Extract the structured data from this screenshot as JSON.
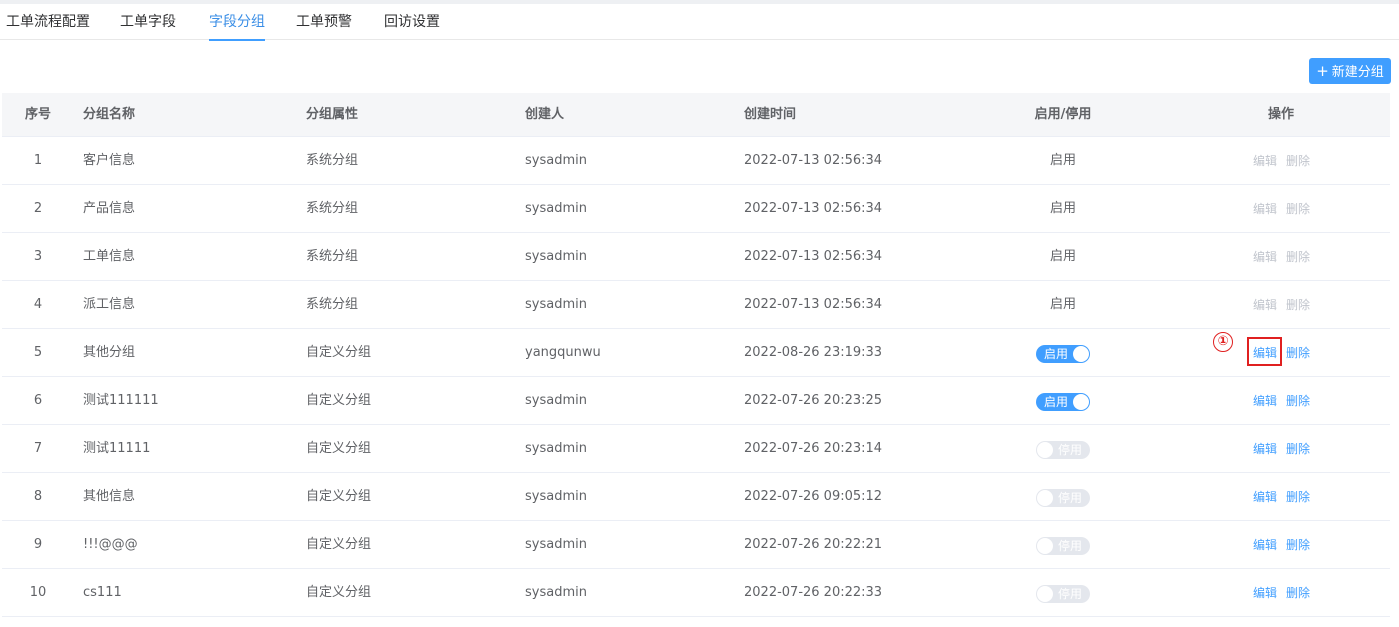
{
  "tabs": [
    {
      "label": "工单流程配置"
    },
    {
      "label": "工单字段"
    },
    {
      "label": "字段分组"
    },
    {
      "label": "工单预警"
    },
    {
      "label": "回访设置"
    }
  ],
  "active_tab": "字段分组",
  "toolbar": {
    "new_group_label": "新建分组",
    "plus_glyph": "+"
  },
  "table": {
    "columns": [
      "序号",
      "分组名称",
      "分组属性",
      "创建人",
      "创建时间",
      "启用/停用",
      "操作"
    ],
    "rows": [
      {
        "no": "1",
        "name": "客户信息",
        "type": "系统分组",
        "creator": "sysadmin",
        "created": "2022-07-13 02:56:34",
        "status": "启用",
        "status_style": "text",
        "edit": "编辑",
        "delete": "删除",
        "actions_enabled": false
      },
      {
        "no": "2",
        "name": "产品信息",
        "type": "系统分组",
        "creator": "sysadmin",
        "created": "2022-07-13 02:56:34",
        "status": "启用",
        "status_style": "text",
        "edit": "编辑",
        "delete": "删除",
        "actions_enabled": false
      },
      {
        "no": "3",
        "name": "工单信息",
        "type": "系统分组",
        "creator": "sysadmin",
        "created": "2022-07-13 02:56:34",
        "status": "启用",
        "status_style": "text",
        "edit": "编辑",
        "delete": "删除",
        "actions_enabled": false
      },
      {
        "no": "4",
        "name": "派工信息",
        "type": "系统分组",
        "creator": "sysadmin",
        "created": "2022-07-13 02:56:34",
        "status": "启用",
        "status_style": "text",
        "edit": "编辑",
        "delete": "删除",
        "actions_enabled": false
      },
      {
        "no": "5",
        "name": "其他分组",
        "type": "自定义分组",
        "creator": "yangqunwu",
        "created": "2022-08-26 23:19:33",
        "status": "启用",
        "status_style": "switch-on",
        "edit": "编辑",
        "delete": "删除",
        "actions_enabled": true
      },
      {
        "no": "6",
        "name": "测试111111",
        "type": "自定义分组",
        "creator": "sysadmin",
        "created": "2022-07-26 20:23:25",
        "status": "启用",
        "status_style": "switch-on",
        "edit": "编辑",
        "delete": "删除",
        "actions_enabled": true
      },
      {
        "no": "7",
        "name": "测试11111",
        "type": "自定义分组",
        "creator": "sysadmin",
        "created": "2022-07-26 20:23:14",
        "status": "停用",
        "status_style": "switch-off",
        "edit": "编辑",
        "delete": "删除",
        "actions_enabled": true
      },
      {
        "no": "8",
        "name": "其他信息",
        "type": "自定义分组",
        "creator": "sysadmin",
        "created": "2022-07-26 09:05:12",
        "status": "停用",
        "status_style": "switch-off",
        "edit": "编辑",
        "delete": "删除",
        "actions_enabled": true
      },
      {
        "no": "9",
        "name": "!!!@@@",
        "type": "自定义分组",
        "creator": "sysadmin",
        "created": "2022-07-26 20:22:21",
        "status": "停用",
        "status_style": "switch-off",
        "edit": "编辑",
        "delete": "删除",
        "actions_enabled": true
      },
      {
        "no": "10",
        "name": "cs111",
        "type": "自定义分组",
        "creator": "sysadmin",
        "created": "2022-07-26 20:22:33",
        "status": "停用",
        "status_style": "switch-off",
        "edit": "编辑",
        "delete": "删除",
        "actions_enabled": true
      }
    ]
  },
  "annotation": {
    "label": "①",
    "target": "row-5-edit",
    "color": "#e02020"
  },
  "colors": {
    "accent": "#409eff",
    "disabled": "#c0c4cc",
    "annotation": "#e02020"
  }
}
